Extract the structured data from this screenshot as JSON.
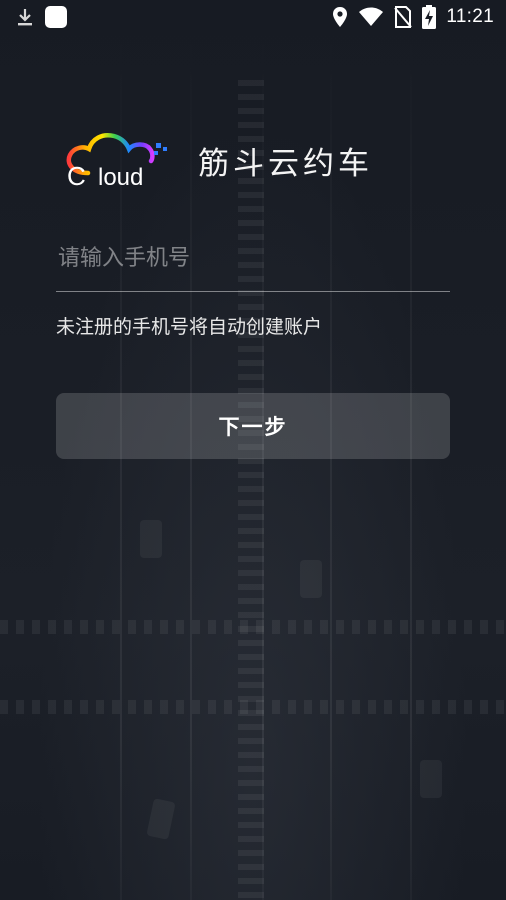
{
  "status_bar": {
    "time": "11:21",
    "left_icons": [
      "download-icon",
      "app-notification-icon"
    ],
    "right_icons": [
      "location-icon",
      "wifi-icon",
      "no-sim-icon",
      "battery-charging-icon"
    ]
  },
  "brand": {
    "logo_text": "loud",
    "logo_letter": "C",
    "title": "筋斗云约车"
  },
  "login": {
    "phone_placeholder": "请输入手机号",
    "phone_value": "",
    "hint": "未注册的手机号将自动创建账户",
    "next_label": "下一步"
  },
  "colors": {
    "background": "#181c24",
    "button_bg": "rgba(255,255,255,0.16)",
    "text": "#ffffff"
  }
}
